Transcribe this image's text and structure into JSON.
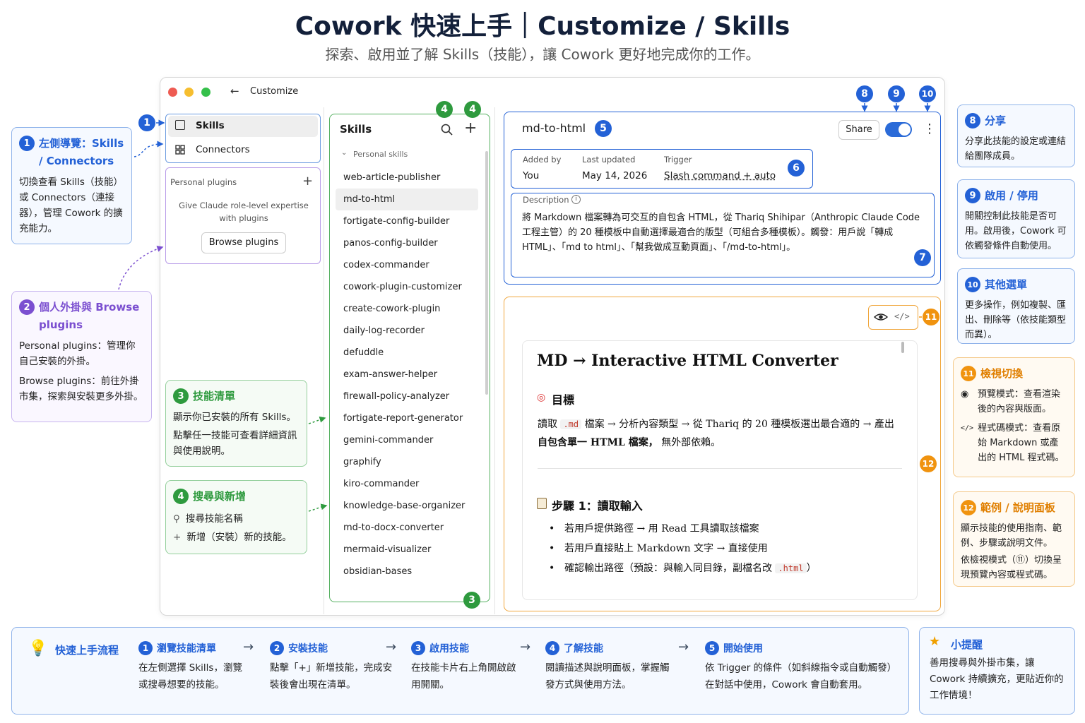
{
  "header": {
    "title": "Cowork 快速上手｜Customize / Skills",
    "subtitle": "探索、啟用並了解 Skills（技能），讓 Cowork 更好地完成你的工作。"
  },
  "window": {
    "back_label": "Customize",
    "nav": {
      "skills": "Skills",
      "connectors": "Connectors"
    },
    "personal": {
      "header": "Personal plugins",
      "hint": "Give Claude role-level expertise with plugins",
      "browse_button": "Browse plugins"
    },
    "skills_list": {
      "title": "Skills",
      "group": "Personal skills",
      "items": [
        "web-article-publisher",
        "md-to-html",
        "fortigate-config-builder",
        "panos-config-builder",
        "codex-commander",
        "cowork-plugin-customizer",
        "create-cowork-plugin",
        "daily-log-recorder",
        "defuddle",
        "exam-answer-helper",
        "firewall-policy-analyzer",
        "fortigate-report-generator",
        "gemini-commander",
        "graphify",
        "kiro-commander",
        "knowledge-base-organizer",
        "md-to-docx-converter",
        "mermaid-visualizer",
        "obsidian-bases"
      ],
      "selected": "md-to-html"
    },
    "detail": {
      "name": "md-to-html",
      "share_button": "Share",
      "toggle_on": true,
      "meta": {
        "added_by_label": "Added by",
        "added_by": "You",
        "updated_label": "Last updated",
        "updated": "May 14, 2026",
        "trigger_label": "Trigger",
        "trigger": "Slash command + auto"
      },
      "description_label": "Description",
      "description": "將 Markdown 檔案轉為可交互的自包含 HTML，從 Thariq Shihipar（Anthropic Claude Code 工程主管）的 20 種模板中自動選擇最適合的版型（可組合多種模板）。觸發：用戶說「轉成 HTML」、「md to html」、「幫我做成互動頁面」、「/md-to-html」。"
    },
    "preview": {
      "heading": "MD → Interactive HTML Converter",
      "goal_title": "目標",
      "goal_text_a": "讀取",
      "goal_code": ".md",
      "goal_text_b": "檔案 → 分析內容類型 → 從 Thariq 的 20 種模板選出最合適的 → 產出",
      "goal_text_bold": "自包含單一 HTML 檔案，",
      "goal_text_c": "無外部依賴。",
      "step1_title": "步驟 1：讀取輸入",
      "step1_items": [
        "若用戶提供路徑 → 用 Read 工具讀取該檔案",
        "若用戶直接貼上 Markdown 文字 → 直接使用"
      ],
      "step1_last_a": "確認輸出路徑（預設：與輸入同目錄，副檔名改",
      "step1_last_code": ".html",
      "step1_last_b": "）"
    }
  },
  "badges": [
    "1",
    "2",
    "3",
    "4",
    "5",
    "6",
    "7",
    "8",
    "9",
    "10",
    "11",
    "12"
  ],
  "callouts": {
    "c1": {
      "num": "1",
      "title": "左側導覽：Skills / Connectors",
      "text": "切換查看 Skills（技能）或 Connectors（連接器），管理 Cowork 的擴充能力。"
    },
    "c2": {
      "num": "2",
      "title": "個人外掛與 Browse plugins",
      "text1": "Personal plugins：管理你自己安裝的外掛。",
      "text2": "Browse plugins：前往外掛市集，探索與安裝更多外掛。"
    },
    "c3": {
      "num": "3",
      "title": "技能清單",
      "text1": "顯示你已安裝的所有 Skills。",
      "text2": "點擊任一技能可查看詳細資訊與使用說明。"
    },
    "c4": {
      "num": "4",
      "title": "搜尋與新增",
      "text1": "搜尋技能名稱",
      "text2": "新增（安裝）新的技能。"
    },
    "c8": {
      "num": "8",
      "title": "分享",
      "text": "分享此技能的設定或連結給團隊成員。"
    },
    "c9": {
      "num": "9",
      "title": "啟用 / 停用",
      "text": "開關控制此技能是否可用。啟用後，Cowork 可依觸發條件自動使用。"
    },
    "c10": {
      "num": "10",
      "title": "其他選單",
      "text": "更多操作，例如複製、匯出、刪除等（依技能類型而異）。"
    },
    "c11": {
      "num": "11",
      "title": "檢視切換",
      "text1": "預覽模式：查看渲染後的內容與版面。",
      "text2": "程式碼模式：查看原始 Markdown 或產出的 HTML 程式碼。"
    },
    "c12": {
      "num": "12",
      "title": "範例 / 說明面板",
      "text1": "顯示技能的使用指南、範例、步驟或說明文件。",
      "text2": "依檢視模式（⑪）切換呈現預覽內容或程式碼。"
    }
  },
  "flow": {
    "title": "快速上手流程",
    "steps": [
      {
        "num": "1",
        "title": "瀏覽技能清單",
        "desc": "在左側選擇 Skills，瀏覽或搜尋想要的技能。"
      },
      {
        "num": "2",
        "title": "安裝技能",
        "desc": "點擊「+」新增技能，完成安裝後會出現在清單。"
      },
      {
        "num": "3",
        "title": "啟用技能",
        "desc": "在技能卡片右上角開啟啟用開關。"
      },
      {
        "num": "4",
        "title": "了解技能",
        "desc": "閱讀描述與說明面板，掌握觸發方式與使用方法。"
      },
      {
        "num": "5",
        "title": "開始使用",
        "desc": "依 Trigger 的條件（如斜線指令或自動觸發）在對話中使用，Cowork 會自動套用。"
      }
    ]
  },
  "tip": {
    "title": "小提醒",
    "text": "善用搜尋與外掛市集，讓 Cowork 持續擴充，更貼近你的工作情境！"
  },
  "colors": {
    "blue": "#2361d6",
    "green": "#2e9a3e",
    "orange": "#f0930f",
    "purple": "#7b4fd0"
  }
}
